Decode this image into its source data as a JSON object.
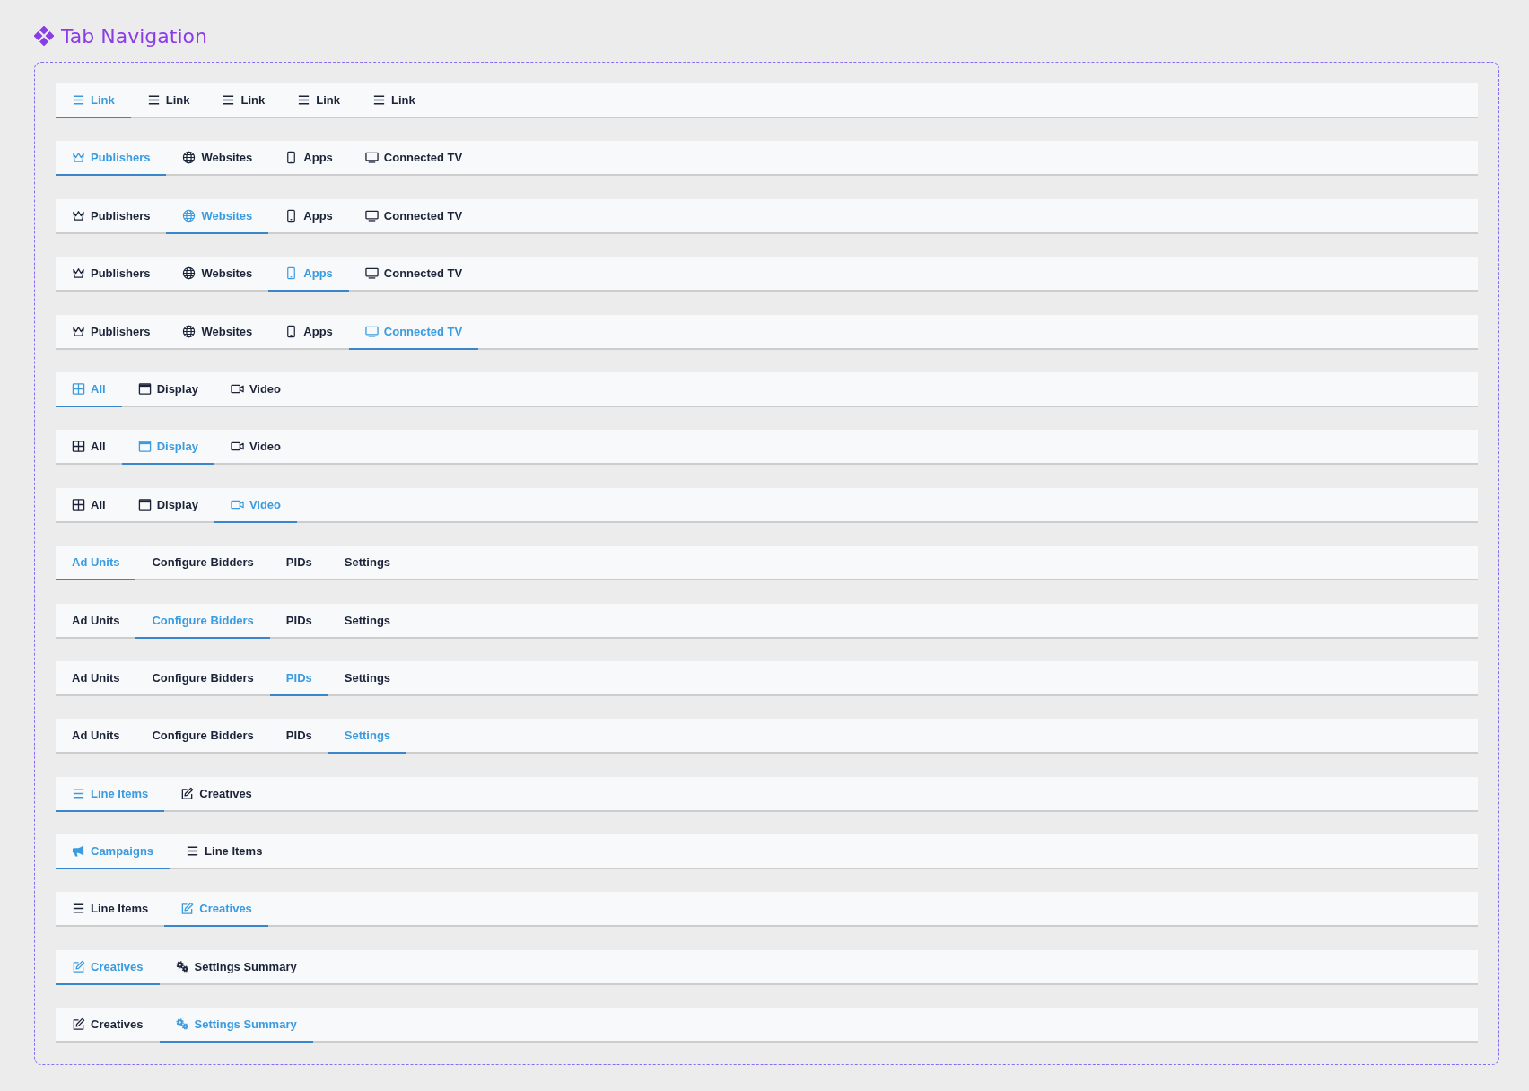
{
  "title": "Tab Navigation",
  "tab_bars": [
    {
      "tabs": [
        {
          "label": "Link",
          "kind": "list",
          "selected": true
        },
        {
          "label": "Link",
          "kind": "list",
          "selected": false
        },
        {
          "label": "Link",
          "kind": "list",
          "selected": false
        },
        {
          "label": "Link",
          "kind": "list",
          "selected": false
        },
        {
          "label": "Link",
          "kind": "list",
          "selected": false
        }
      ]
    },
    {
      "tabs": [
        {
          "label": "Publishers",
          "kind": "crown",
          "selected": true
        },
        {
          "label": "Websites",
          "kind": "globe",
          "selected": false
        },
        {
          "label": "Apps",
          "kind": "phone",
          "selected": false
        },
        {
          "label": "Connected TV",
          "kind": "tv",
          "selected": false
        }
      ]
    },
    {
      "tabs": [
        {
          "label": "Publishers",
          "kind": "crown",
          "selected": false
        },
        {
          "label": "Websites",
          "kind": "globe",
          "selected": true
        },
        {
          "label": "Apps",
          "kind": "phone",
          "selected": false
        },
        {
          "label": "Connected TV",
          "kind": "tv",
          "selected": false
        }
      ]
    },
    {
      "tabs": [
        {
          "label": "Publishers",
          "kind": "crown",
          "selected": false
        },
        {
          "label": "Websites",
          "kind": "globe",
          "selected": false
        },
        {
          "label": "Apps",
          "kind": "phone",
          "selected": true
        },
        {
          "label": "Connected TV",
          "kind": "tv",
          "selected": false
        }
      ]
    },
    {
      "tabs": [
        {
          "label": "Publishers",
          "kind": "crown",
          "selected": false
        },
        {
          "label": "Websites",
          "kind": "globe",
          "selected": false
        },
        {
          "label": "Apps",
          "kind": "phone",
          "selected": false
        },
        {
          "label": "Connected TV",
          "kind": "tv",
          "selected": true
        }
      ]
    },
    {
      "tabs": [
        {
          "label": "All",
          "kind": "grid",
          "selected": true
        },
        {
          "label": "Display",
          "kind": "window",
          "selected": false
        },
        {
          "label": "Video",
          "kind": "video",
          "selected": false
        }
      ]
    },
    {
      "tabs": [
        {
          "label": "All",
          "kind": "grid",
          "selected": false
        },
        {
          "label": "Display",
          "kind": "window",
          "selected": true
        },
        {
          "label": "Video",
          "kind": "video",
          "selected": false
        }
      ]
    },
    {
      "tabs": [
        {
          "label": "All",
          "kind": "grid",
          "selected": false
        },
        {
          "label": "Display",
          "kind": "window",
          "selected": false
        },
        {
          "label": "Video",
          "kind": "video",
          "selected": true
        }
      ]
    },
    {
      "tabs": [
        {
          "label": "Ad Units",
          "kind": "text",
          "selected": true
        },
        {
          "label": "Configure Bidders",
          "kind": "text",
          "selected": false
        },
        {
          "label": "PIDs",
          "kind": "text",
          "selected": false
        },
        {
          "label": "Settings",
          "kind": "text",
          "selected": false
        }
      ]
    },
    {
      "tabs": [
        {
          "label": "Ad Units",
          "kind": "text",
          "selected": false
        },
        {
          "label": "Configure Bidders",
          "kind": "text",
          "selected": true
        },
        {
          "label": "PIDs",
          "kind": "text",
          "selected": false
        },
        {
          "label": "Settings",
          "kind": "text",
          "selected": false
        }
      ]
    },
    {
      "tabs": [
        {
          "label": "Ad Units",
          "kind": "text",
          "selected": false
        },
        {
          "label": "Configure Bidders",
          "kind": "text",
          "selected": false
        },
        {
          "label": "PIDs",
          "kind": "text",
          "selected": true
        },
        {
          "label": "Settings",
          "kind": "text",
          "selected": false
        }
      ]
    },
    {
      "tabs": [
        {
          "label": "Ad Units",
          "kind": "text",
          "selected": false
        },
        {
          "label": "Configure Bidders",
          "kind": "text",
          "selected": false
        },
        {
          "label": "PIDs",
          "kind": "text",
          "selected": false
        },
        {
          "label": "Settings",
          "kind": "text",
          "selected": true
        }
      ]
    },
    {
      "tabs": [
        {
          "label": "Line Items",
          "kind": "list",
          "selected": true
        },
        {
          "label": "Creatives",
          "kind": "edit",
          "selected": false
        }
      ]
    },
    {
      "tabs": [
        {
          "label": "Campaigns",
          "kind": "megaphone",
          "selected": true
        },
        {
          "label": "Line Items",
          "kind": "list",
          "selected": false
        }
      ]
    },
    {
      "tabs": [
        {
          "label": "Line Items",
          "kind": "list",
          "selected": false
        },
        {
          "label": "Creatives",
          "kind": "edit",
          "selected": true
        }
      ]
    },
    {
      "tabs": [
        {
          "label": "Creatives",
          "kind": "edit",
          "selected": true
        },
        {
          "label": "Settings Summary",
          "kind": "gears",
          "selected": false
        }
      ]
    },
    {
      "tabs": [
        {
          "label": "Creatives",
          "kind": "edit",
          "selected": false
        },
        {
          "label": "Settings Summary",
          "kind": "gears",
          "selected": true
        }
      ]
    }
  ]
}
